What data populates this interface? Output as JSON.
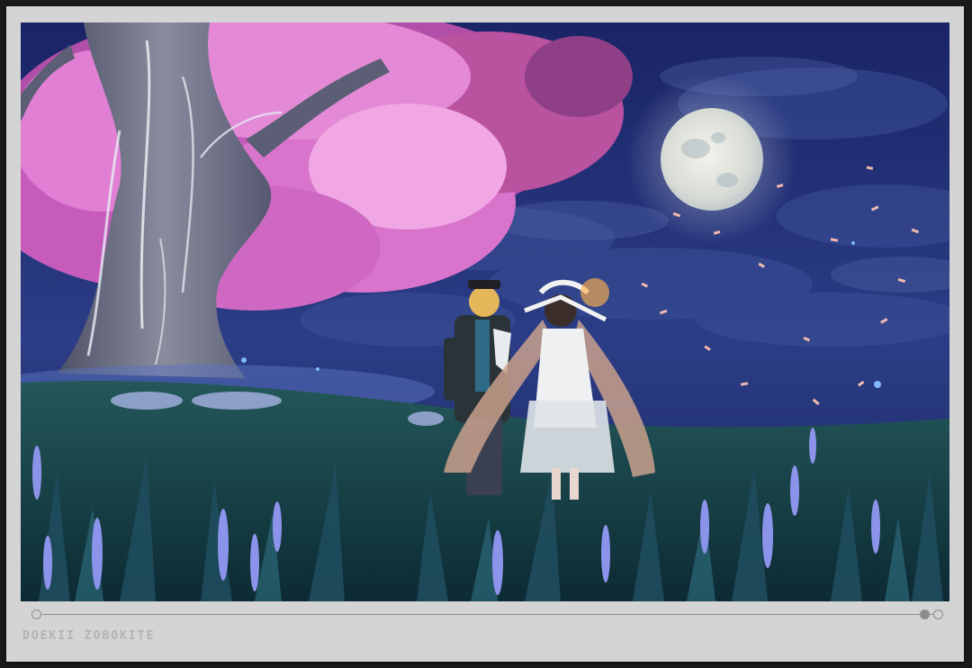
{
  "scene": {
    "description_icon": "night-moon-blossom-tree-scene",
    "colors": {
      "sky_top": "#1d2a6e",
      "sky_bottom": "#2b3f8a",
      "moon": "#dfe6ea",
      "blossom": "#e37ad0",
      "trunk": "#7a7e90",
      "grass": "#1b4c4a",
      "flowers": "#8a8ee6",
      "frame": "#d4d4d4"
    }
  },
  "footer": {
    "watermark_text": "DOEKII ZOBOKITE"
  }
}
